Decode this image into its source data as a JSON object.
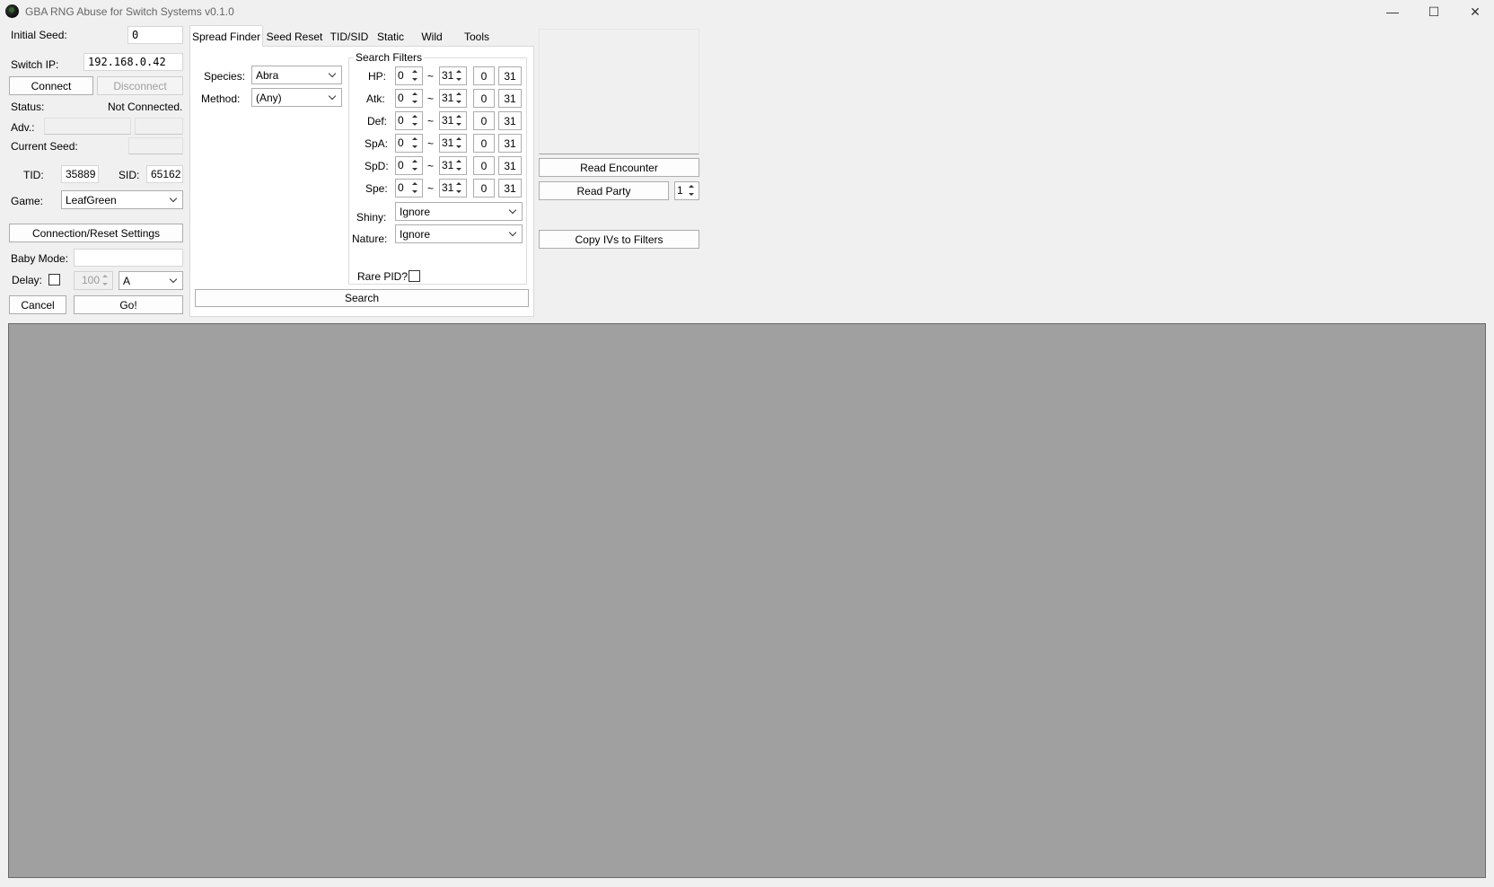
{
  "window": {
    "title": "GBA RNG Abuse for Switch Systems v0.1.0",
    "minimize_glyph": "—",
    "maximize_glyph": "☐",
    "close_glyph": "✕"
  },
  "left": {
    "initial_seed_label": "Initial Seed:",
    "initial_seed_value": "0",
    "switch_ip_label": "Switch IP:",
    "switch_ip_value": "192.168.0.42",
    "connect_label": "Connect",
    "disconnect_label": "Disconnect",
    "status_label": "Status:",
    "status_value": "Not Connected.",
    "adv_label": "Adv.:",
    "current_seed_label": "Current Seed:",
    "tid_label": "TID:",
    "tid_value": "35889",
    "sid_label": "SID:",
    "sid_value": "65162",
    "game_label": "Game:",
    "game_value": "LeafGreen",
    "conn_settings_label": "Connection/Reset Settings",
    "baby_mode_label": "Baby Mode:",
    "delay_label": "Delay:",
    "delay_value": "100",
    "button_value": "A",
    "cancel_label": "Cancel",
    "go_label": "Go!"
  },
  "tabs": [
    {
      "label": "Spread Finder"
    },
    {
      "label": "Seed Reset"
    },
    {
      "label": "TID/SID"
    },
    {
      "label": "Static"
    },
    {
      "label": "Wild"
    },
    {
      "label": "Tools"
    }
  ],
  "spread": {
    "species_label": "Species:",
    "species_value": "Abra",
    "method_label": "Method:",
    "method_value": "(Any)",
    "filters_title": "Search Filters",
    "tilde": "~",
    "ivs": [
      {
        "label": "HP:",
        "min": "0",
        "max": "31",
        "btn_min": "0",
        "btn_max": "31"
      },
      {
        "label": "Atk:",
        "min": "0",
        "max": "31",
        "btn_min": "0",
        "btn_max": "31"
      },
      {
        "label": "Def:",
        "min": "0",
        "max": "31",
        "btn_min": "0",
        "btn_max": "31"
      },
      {
        "label": "SpA:",
        "min": "0",
        "max": "31",
        "btn_min": "0",
        "btn_max": "31"
      },
      {
        "label": "SpD:",
        "min": "0",
        "max": "31",
        "btn_min": "0",
        "btn_max": "31"
      },
      {
        "label": "Spe:",
        "min": "0",
        "max": "31",
        "btn_min": "0",
        "btn_max": "31"
      }
    ],
    "shiny_label": "Shiny:",
    "shiny_value": "Ignore",
    "nature_label": "Nature:",
    "nature_value": "Ignore",
    "rare_pid_label": "Rare PID?",
    "search_label": "Search"
  },
  "right": {
    "read_encounter_label": "Read Encounter",
    "read_party_label": "Read Party",
    "party_slot_value": "1",
    "copy_ivs_label": "Copy IVs to Filters"
  }
}
